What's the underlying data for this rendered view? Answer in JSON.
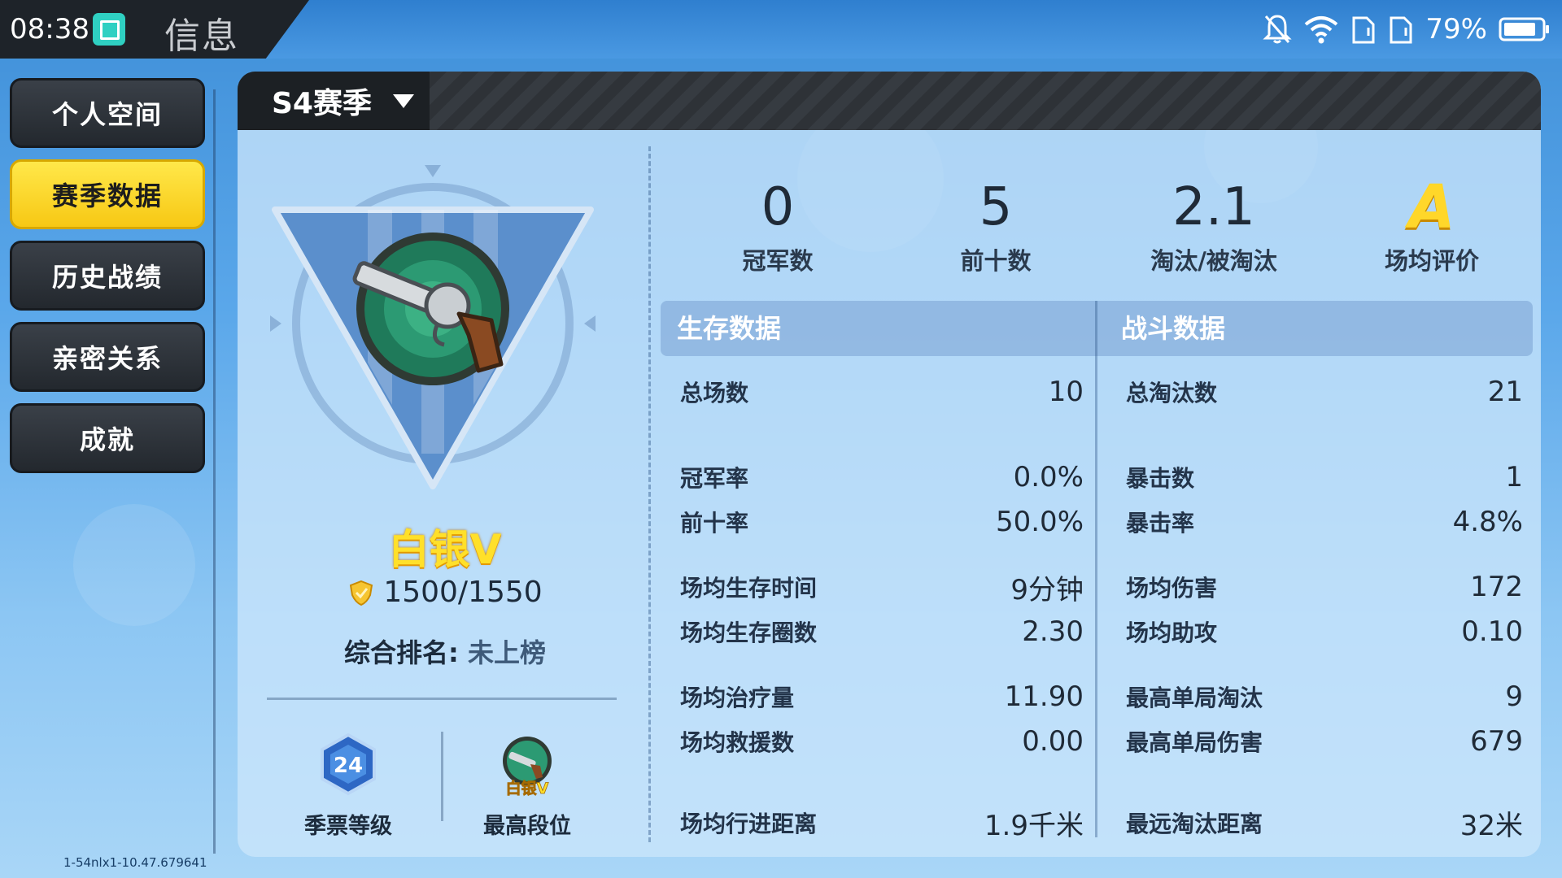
{
  "status_bar": {
    "time": "08:38",
    "page_title": "信息",
    "battery": "79%",
    "icons": [
      "screen-capture-icon",
      "bell-off-icon",
      "wifi-icon",
      "sim-card-icon",
      "sim-card-icon",
      "battery-icon"
    ]
  },
  "sidebar": {
    "items": [
      {
        "label": "个人空间"
      },
      {
        "label": "赛季数据"
      },
      {
        "label": "历史战绩"
      },
      {
        "label": "亲密关系"
      },
      {
        "label": "成就"
      }
    ],
    "active_index": 1
  },
  "build_id": "1-54nlx1-10.47.679641",
  "season": {
    "label": "S4赛季"
  },
  "rank": {
    "name": "白银V",
    "points": "1500/1550",
    "overall_label": "综合排名:",
    "overall_value": "未上榜",
    "badges": [
      {
        "value": "24",
        "caption": "季票等级"
      },
      {
        "value": "白银V",
        "caption": "最高段位"
      }
    ]
  },
  "summary": [
    {
      "value": "0",
      "label": "冠军数"
    },
    {
      "value": "5",
      "label": "前十数"
    },
    {
      "value": "2.1",
      "label": "淘汰/被淘汰"
    },
    {
      "value": "A",
      "label": "场均评价"
    }
  ],
  "survival": {
    "title": "生存数据",
    "rows": [
      {
        "label": "总场数",
        "value": "10"
      },
      {
        "label": "冠军率",
        "value": "0.0%"
      },
      {
        "label": "前十率",
        "value": "50.0%"
      },
      {
        "label": "场均生存时间",
        "value": "9分钟"
      },
      {
        "label": "场均生存圈数",
        "value": "2.30"
      },
      {
        "label": "场均治疗量",
        "value": "11.90"
      },
      {
        "label": "场均救援数",
        "value": "0.00"
      },
      {
        "label": "场均行进距离",
        "value": "1.9千米"
      }
    ]
  },
  "combat": {
    "title": "战斗数据",
    "rows": [
      {
        "label": "总淘汰数",
        "value": "21"
      },
      {
        "label": "暴击数",
        "value": "1"
      },
      {
        "label": "暴击率",
        "value": "4.8%"
      },
      {
        "label": "场均伤害",
        "value": "172"
      },
      {
        "label": "场均助攻",
        "value": "0.10"
      },
      {
        "label": "最高单局淘汰",
        "value": "9"
      },
      {
        "label": "最高单局伤害",
        "value": "679"
      },
      {
        "label": "最远淘汰距离",
        "value": "32米"
      }
    ]
  }
}
